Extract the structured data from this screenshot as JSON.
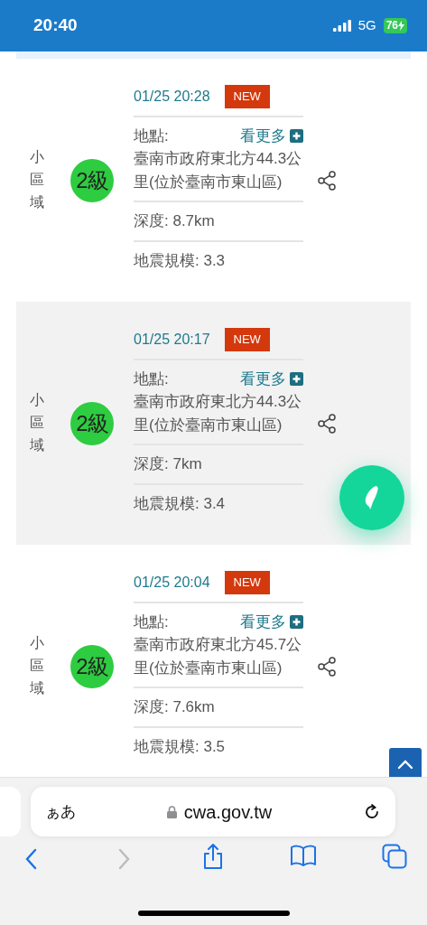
{
  "status_bar": {
    "time": "20:40",
    "network": "5G",
    "battery": "76"
  },
  "quakes": [
    {
      "area": "小區域",
      "intensity": "2級",
      "time": "01/25 20:28",
      "badge": "NEW",
      "location_label": "地點:",
      "more": "看更多",
      "location": "臺南市政府東北方44.3公里(位於臺南市東山區)",
      "depth": "深度: 8.7km",
      "magnitude": "地震規模: 3.3",
      "highlighted": false
    },
    {
      "area": "小區域",
      "intensity": "2級",
      "time": "01/25 20:17",
      "badge": "NEW",
      "location_label": "地點:",
      "more": "看更多",
      "location": "臺南市政府東北方44.3公里(位於臺南市東山區)",
      "depth": "深度: 7km",
      "magnitude": "地震規模: 3.4",
      "highlighted": true
    },
    {
      "area": "小區域",
      "intensity": "2級",
      "time": "01/25 20:04",
      "badge": "NEW",
      "location_label": "地點:",
      "more": "看更多",
      "location": "臺南市政府東北方45.7公里(位於臺南市東山區)",
      "depth": "深度: 7.6km",
      "magnitude": "地震規模: 3.5",
      "highlighted": false
    }
  ],
  "browser": {
    "text_size": "ぁあ",
    "url": "cwa.gov.tw"
  }
}
